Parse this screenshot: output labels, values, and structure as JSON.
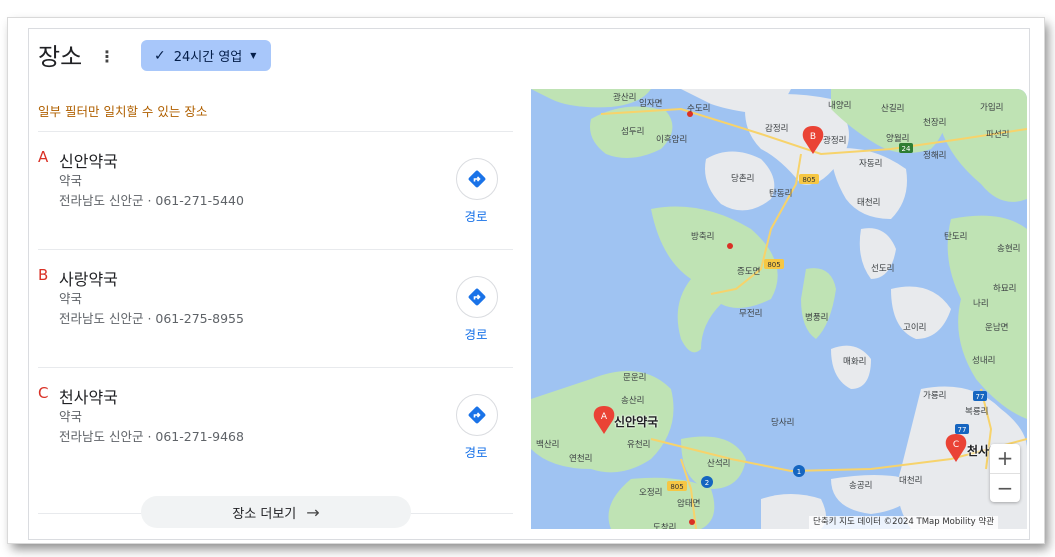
{
  "header": {
    "title": "장소",
    "more_options": "⋮",
    "filter_chip": "24시간 영업"
  },
  "partial_match_note": "일부 필터만 일치할 수 있는 장소",
  "results": [
    {
      "letter": "A",
      "name": "신안약국",
      "category": "약국",
      "address": "전라남도 신안군 · 061-271-5440",
      "directions_label": "경로"
    },
    {
      "letter": "B",
      "name": "사랑약국",
      "category": "약국",
      "address": "전라남도 신안군 · 061-275-8955",
      "directions_label": "경로"
    },
    {
      "letter": "C",
      "name": "천사약국",
      "category": "약국",
      "address": "전라남도 신안군 · 061-271-9468",
      "directions_label": "경로"
    }
  ],
  "more_places_label": "장소 더보기",
  "map": {
    "pins": [
      {
        "letter": "A",
        "label": "신안약국"
      },
      {
        "letter": "B",
        "label": ""
      },
      {
        "letter": "C",
        "label": "천사약국"
      }
    ],
    "place_labels": [
      "광산리",
      "임자면",
      "수도리",
      "내양리",
      "산길리",
      "가입리",
      "섬두리",
      "이흑암리",
      "감정리",
      "광정리",
      "양월리",
      "천장리",
      "파선리",
      "자동리",
      "정해리",
      "당촌리",
      "탄동리",
      "태천리",
      "방축리",
      "탄도리",
      "증도면",
      "선도리",
      "송현리",
      "하묘리",
      "나리",
      "무전리",
      "병풍리",
      "고이리",
      "운남면",
      "성내리",
      "매화리",
      "문운리",
      "송산리",
      "가룡리",
      "당사리",
      "백산리",
      "유천리",
      "복룡리",
      "연천리",
      "산석리",
      "오정리",
      "암태면",
      "송공리",
      "대천리",
      "도창리"
    ],
    "road_badges": [
      "24",
      "805",
      "805",
      "805",
      "77",
      "77",
      "1",
      "2"
    ],
    "zoom_in": "+",
    "zoom_out": "−",
    "attribution": "단축키   지도 데이터 ©2024 TMap Mobility   약관"
  },
  "colors": {
    "accent": "#1a73e8",
    "chip_bg": "#a8c7fa",
    "letter_red": "#d93025",
    "note_orange": "#b06000",
    "water": "#9fc3f2",
    "land": "#e8eaed",
    "green": "#bfe3b4"
  }
}
